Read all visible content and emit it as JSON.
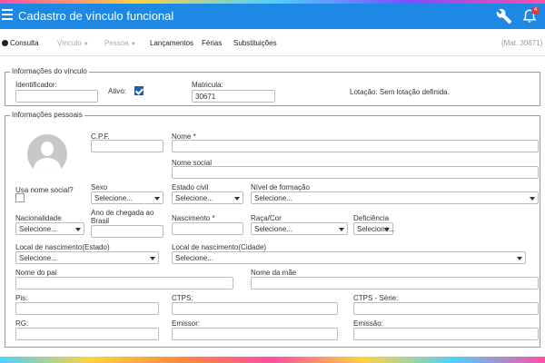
{
  "header": {
    "title": "Cadastro de vínculo funcional",
    "notification_count": "4"
  },
  "menu": {
    "consulta": "Consulta",
    "vinculo": "Vínculo",
    "pessoa": "Pessoa",
    "lancamentos": "Lançamentos",
    "ferias": "Férias",
    "substituicoes": "Substituições",
    "matricula_badge": "(Mat. 30671)"
  },
  "vinculo": {
    "legend": "Informações do vínculo",
    "identificador_label": "Identificador:",
    "identificador_value": "",
    "ativo_label": "Ativo:",
    "ativo_checked": true,
    "matricula_label": "Matricula:",
    "matricula_value": "30671",
    "lotacao_text": "Lotação: Sem lotação definida."
  },
  "pessoais": {
    "legend": "Informações pessoais",
    "cpf_label": "C.P.F.",
    "nome_label": "Nome",
    "nome_required": "*",
    "nome_social_label": "Nome social",
    "usa_nome_social_label": "Usa nome social?",
    "sexo_label": "Sexo",
    "estado_civil_label": "Estado civil",
    "nivel_formacao_label": "Nível de formação",
    "nacionalidade_label": "Nacionalidade",
    "ano_chegada_label_1": "Ano de chegada ao",
    "ano_chegada_label_2": "Brasil",
    "nascimento_label": "Nascimento",
    "nascimento_required": "*",
    "raca_label": "Raça/Cor",
    "deficiencia_label": "Deficiência",
    "local_nasc_estado_label": "Local de nascimento(Estado)",
    "local_nasc_cidade_label": "Local de nascimento(Cidade)",
    "nome_pai_label": "Nome do pai",
    "nome_mae_label": "Nome da mãe",
    "pis_label": "Pis:",
    "ctps_label": "CTPS:",
    "ctps_serie_label": "CTPS - Série:",
    "rg_label": "RG:",
    "emissor_label": "Emissor:",
    "emissao_label": "Emissão:",
    "select_placeholder": "Selecione..."
  },
  "colors": {
    "header_bg": "#1e88e5",
    "checkbox_on": "#1e5fa8"
  }
}
